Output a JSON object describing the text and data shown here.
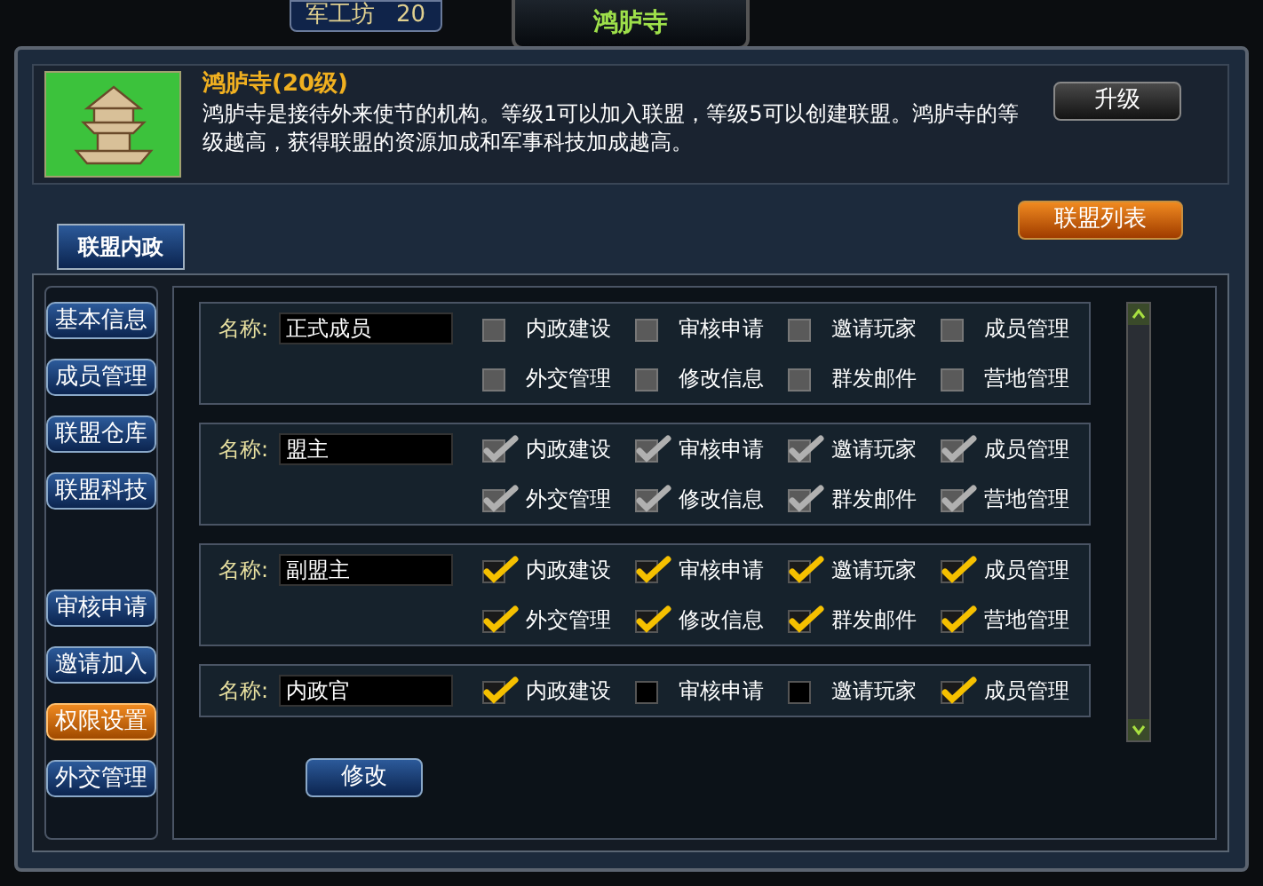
{
  "hud": {
    "label": "军工坊",
    "value": "20"
  },
  "window": {
    "title": "鸿胪寺"
  },
  "building": {
    "title": "鸿胪寺(20级)",
    "description": "鸿胪寺是接待外来使节的机构。等级1可以加入联盟，等级5可以创建联盟。鸿胪寺的等级越高，获得联盟的资源加成和军事科技加成越高。",
    "upgrade_button": "升级"
  },
  "tabs": [
    {
      "label": "联盟内政",
      "selected": true
    }
  ],
  "alliance_list_button": "联盟列表",
  "sidebar": {
    "groups": [
      {
        "items": [
          {
            "label": "基本信息",
            "selected": false
          },
          {
            "label": "成员管理",
            "selected": false
          },
          {
            "label": "联盟仓库",
            "selected": false
          },
          {
            "label": "联盟科技",
            "selected": false
          }
        ]
      },
      {
        "items": [
          {
            "label": "审核申请",
            "selected": false
          },
          {
            "label": "邀请加入",
            "selected": false
          },
          {
            "label": "权限设置",
            "selected": true
          },
          {
            "label": "外交管理",
            "selected": false
          }
        ]
      }
    ]
  },
  "ranks": [
    {
      "name_label": "名称:",
      "name": "正式成员",
      "permissions": [
        {
          "label": "内政建设",
          "checked": false,
          "disabled": true
        },
        {
          "label": "审核申请",
          "checked": false,
          "disabled": true
        },
        {
          "label": "邀请玩家",
          "checked": false,
          "disabled": true
        },
        {
          "label": "成员管理",
          "checked": false,
          "disabled": true
        },
        {
          "label": "外交管理",
          "checked": false,
          "disabled": true
        },
        {
          "label": "修改信息",
          "checked": false,
          "disabled": true
        },
        {
          "label": "群发邮件",
          "checked": false,
          "disabled": true
        },
        {
          "label": "营地管理",
          "checked": false,
          "disabled": true
        }
      ]
    },
    {
      "name_label": "名称:",
      "name": "盟主",
      "permissions": [
        {
          "label": "内政建设",
          "checked": true,
          "disabled": true
        },
        {
          "label": "审核申请",
          "checked": true,
          "disabled": true
        },
        {
          "label": "邀请玩家",
          "checked": true,
          "disabled": true
        },
        {
          "label": "成员管理",
          "checked": true,
          "disabled": true
        },
        {
          "label": "外交管理",
          "checked": true,
          "disabled": true
        },
        {
          "label": "修改信息",
          "checked": true,
          "disabled": true
        },
        {
          "label": "群发邮件",
          "checked": true,
          "disabled": true
        },
        {
          "label": "营地管理",
          "checked": true,
          "disabled": true
        }
      ]
    },
    {
      "name_label": "名称:",
      "name": "副盟主",
      "permissions": [
        {
          "label": "内政建设",
          "checked": true,
          "disabled": false
        },
        {
          "label": "审核申请",
          "checked": true,
          "disabled": false
        },
        {
          "label": "邀请玩家",
          "checked": true,
          "disabled": false
        },
        {
          "label": "成员管理",
          "checked": true,
          "disabled": false
        },
        {
          "label": "外交管理",
          "checked": true,
          "disabled": false
        },
        {
          "label": "修改信息",
          "checked": true,
          "disabled": false
        },
        {
          "label": "群发邮件",
          "checked": true,
          "disabled": false
        },
        {
          "label": "营地管理",
          "checked": true,
          "disabled": false
        }
      ]
    },
    {
      "name_label": "名称:",
      "name": "内政官",
      "permissions": [
        {
          "label": "内政建设",
          "checked": true,
          "disabled": false
        },
        {
          "label": "审核申请",
          "checked": false,
          "disabled": false
        },
        {
          "label": "邀请玩家",
          "checked": false,
          "disabled": false
        },
        {
          "label": "成员管理",
          "checked": true,
          "disabled": false
        }
      ]
    }
  ],
  "modify_button": "修改"
}
